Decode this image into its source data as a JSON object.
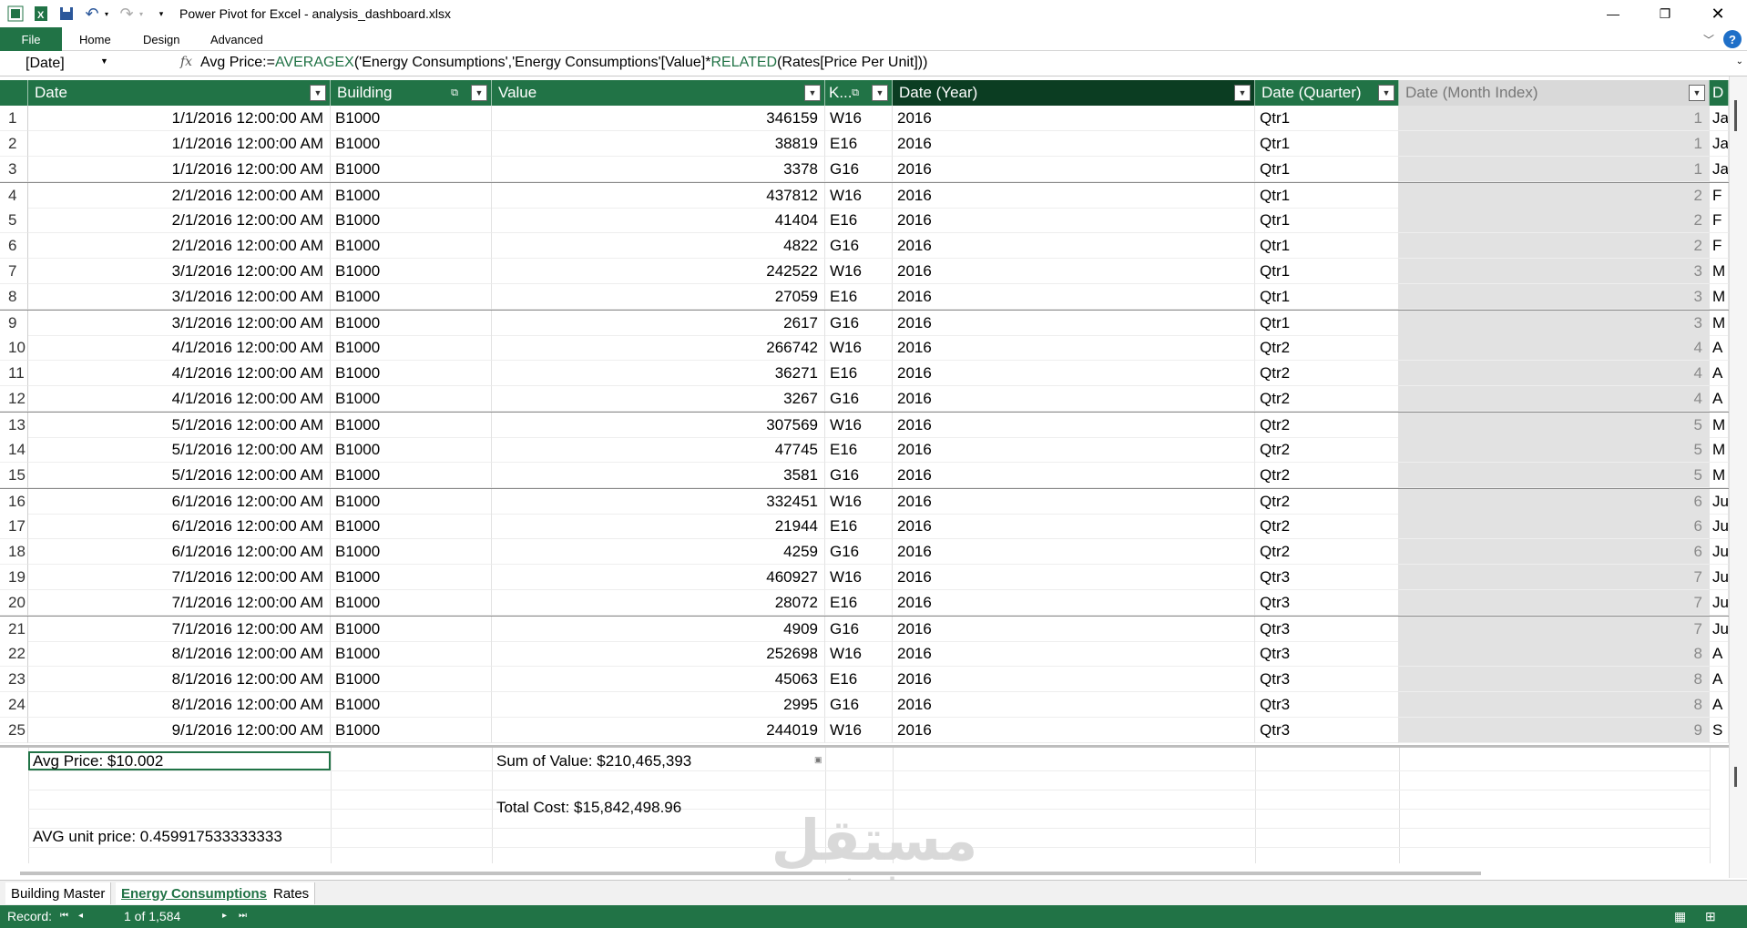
{
  "title": "Power Pivot for Excel - analysis_dashboard.xlsx",
  "ribbon": {
    "tabs": [
      "File",
      "Home",
      "Design",
      "Advanced"
    ]
  },
  "formula_bar": {
    "name_box": "[Date]",
    "fx": "fx",
    "formula_parts": [
      "Avg Price:=",
      "AVERAGEX",
      "('Energy Consumptions','Energy Consumptions'[Value]*",
      "RELATED",
      "(Rates[Price Per Unit]))"
    ]
  },
  "columns": {
    "date": "Date",
    "building": "Building",
    "value": "Value",
    "key": "K...",
    "year": "Date (Year)",
    "quarter": "Date (Quarter)",
    "month_index": "Date (Month Index)",
    "month": "D"
  },
  "rows": [
    {
      "n": "1",
      "date": "1/1/2016 12:00:00 AM",
      "bld": "B1000",
      "val": "346159",
      "key": "W16",
      "year": "2016",
      "qtr": "Qtr1",
      "mi": "1",
      "mon": "Ja"
    },
    {
      "n": "2",
      "date": "1/1/2016 12:00:00 AM",
      "bld": "B1000",
      "val": "38819",
      "key": "E16",
      "year": "2016",
      "qtr": "Qtr1",
      "mi": "1",
      "mon": "Ja"
    },
    {
      "n": "3",
      "date": "1/1/2016 12:00:00 AM",
      "bld": "B1000",
      "val": "3378",
      "key": "G16",
      "year": "2016",
      "qtr": "Qtr1",
      "mi": "1",
      "mon": "Ja"
    },
    {
      "n": "4",
      "date": "2/1/2016 12:00:00 AM",
      "bld": "B1000",
      "val": "437812",
      "key": "W16",
      "year": "2016",
      "qtr": "Qtr1",
      "mi": "2",
      "mon": "F"
    },
    {
      "n": "5",
      "date": "2/1/2016 12:00:00 AM",
      "bld": "B1000",
      "val": "41404",
      "key": "E16",
      "year": "2016",
      "qtr": "Qtr1",
      "mi": "2",
      "mon": "F"
    },
    {
      "n": "6",
      "date": "2/1/2016 12:00:00 AM",
      "bld": "B1000",
      "val": "4822",
      "key": "G16",
      "year": "2016",
      "qtr": "Qtr1",
      "mi": "2",
      "mon": "F"
    },
    {
      "n": "7",
      "date": "3/1/2016 12:00:00 AM",
      "bld": "B1000",
      "val": "242522",
      "key": "W16",
      "year": "2016",
      "qtr": "Qtr1",
      "mi": "3",
      "mon": "M"
    },
    {
      "n": "8",
      "date": "3/1/2016 12:00:00 AM",
      "bld": "B1000",
      "val": "27059",
      "key": "E16",
      "year": "2016",
      "qtr": "Qtr1",
      "mi": "3",
      "mon": "M"
    },
    {
      "n": "9",
      "date": "3/1/2016 12:00:00 AM",
      "bld": "B1000",
      "val": "2617",
      "key": "G16",
      "year": "2016",
      "qtr": "Qtr1",
      "mi": "3",
      "mon": "M"
    },
    {
      "n": "10",
      "date": "4/1/2016 12:00:00 AM",
      "bld": "B1000",
      "val": "266742",
      "key": "W16",
      "year": "2016",
      "qtr": "Qtr2",
      "mi": "4",
      "mon": "A"
    },
    {
      "n": "11",
      "date": "4/1/2016 12:00:00 AM",
      "bld": "B1000",
      "val": "36271",
      "key": "E16",
      "year": "2016",
      "qtr": "Qtr2",
      "mi": "4",
      "mon": "A"
    },
    {
      "n": "12",
      "date": "4/1/2016 12:00:00 AM",
      "bld": "B1000",
      "val": "3267",
      "key": "G16",
      "year": "2016",
      "qtr": "Qtr2",
      "mi": "4",
      "mon": "A"
    },
    {
      "n": "13",
      "date": "5/1/2016 12:00:00 AM",
      "bld": "B1000",
      "val": "307569",
      "key": "W16",
      "year": "2016",
      "qtr": "Qtr2",
      "mi": "5",
      "mon": "M"
    },
    {
      "n": "14",
      "date": "5/1/2016 12:00:00 AM",
      "bld": "B1000",
      "val": "47745",
      "key": "E16",
      "year": "2016",
      "qtr": "Qtr2",
      "mi": "5",
      "mon": "M"
    },
    {
      "n": "15",
      "date": "5/1/2016 12:00:00 AM",
      "bld": "B1000",
      "val": "3581",
      "key": "G16",
      "year": "2016",
      "qtr": "Qtr2",
      "mi": "5",
      "mon": "M"
    },
    {
      "n": "16",
      "date": "6/1/2016 12:00:00 AM",
      "bld": "B1000",
      "val": "332451",
      "key": "W16",
      "year": "2016",
      "qtr": "Qtr2",
      "mi": "6",
      "mon": "Ju"
    },
    {
      "n": "17",
      "date": "6/1/2016 12:00:00 AM",
      "bld": "B1000",
      "val": "21944",
      "key": "E16",
      "year": "2016",
      "qtr": "Qtr2",
      "mi": "6",
      "mon": "Ju"
    },
    {
      "n": "18",
      "date": "6/1/2016 12:00:00 AM",
      "bld": "B1000",
      "val": "4259",
      "key": "G16",
      "year": "2016",
      "qtr": "Qtr2",
      "mi": "6",
      "mon": "Ju"
    },
    {
      "n": "19",
      "date": "7/1/2016 12:00:00 AM",
      "bld": "B1000",
      "val": "460927",
      "key": "W16",
      "year": "2016",
      "qtr": "Qtr3",
      "mi": "7",
      "mon": "Ju"
    },
    {
      "n": "20",
      "date": "7/1/2016 12:00:00 AM",
      "bld": "B1000",
      "val": "28072",
      "key": "E16",
      "year": "2016",
      "qtr": "Qtr3",
      "mi": "7",
      "mon": "Ju"
    },
    {
      "n": "21",
      "date": "7/1/2016 12:00:00 AM",
      "bld": "B1000",
      "val": "4909",
      "key": "G16",
      "year": "2016",
      "qtr": "Qtr3",
      "mi": "7",
      "mon": "Ju"
    },
    {
      "n": "22",
      "date": "8/1/2016 12:00:00 AM",
      "bld": "B1000",
      "val": "252698",
      "key": "W16",
      "year": "2016",
      "qtr": "Qtr3",
      "mi": "8",
      "mon": "A"
    },
    {
      "n": "23",
      "date": "8/1/2016 12:00:00 AM",
      "bld": "B1000",
      "val": "45063",
      "key": "E16",
      "year": "2016",
      "qtr": "Qtr3",
      "mi": "8",
      "mon": "A"
    },
    {
      "n": "24",
      "date": "8/1/2016 12:00:00 AM",
      "bld": "B1000",
      "val": "2995",
      "key": "G16",
      "year": "2016",
      "qtr": "Qtr3",
      "mi": "8",
      "mon": "A"
    },
    {
      "n": "25",
      "date": "9/1/2016 12:00:00 AM",
      "bld": "B1000",
      "val": "244019",
      "key": "W16",
      "year": "2016",
      "qtr": "Qtr3",
      "mi": "9",
      "mon": "S"
    }
  ],
  "calc_area": {
    "avg_price": "Avg Price: $10.002",
    "sum_value": "Sum of Value: $210,465,393",
    "total_cost": "Total Cost: $15,842,498.96",
    "avg_unit_price": "AVG unit price: 0.459917533333333"
  },
  "sheets": [
    "Building Master",
    "Energy Consumptions",
    "Rates"
  ],
  "active_sheet": "Energy Consumptions",
  "status": {
    "label": "Record:",
    "position": "1 of 1,584"
  },
  "watermark": {
    "arabic": "مستقل",
    "latin": "mostaql.com"
  },
  "colors": {
    "accent": "#217346",
    "header": "#217346",
    "selected_header": "#0b3d22"
  }
}
